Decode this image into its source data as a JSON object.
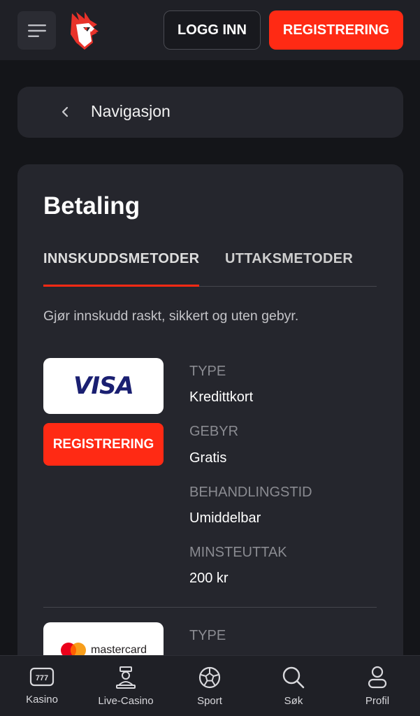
{
  "header": {
    "login_label": "LOGG INN",
    "register_label": "REGISTRERING"
  },
  "nav": {
    "label": "Navigasjon"
  },
  "page": {
    "title": "Betaling",
    "tabs": [
      {
        "label": "INNSKUDDSMETODER",
        "active": true
      },
      {
        "label": "UTTAKSMETODER",
        "active": false
      }
    ],
    "intro": "Gjør innskudd raskt, sikkert og uten gebyr."
  },
  "methods": [
    {
      "logo_text": "VISA",
      "register_label": "REGISTRERING",
      "type_label": "TYPE",
      "type_value": "Kredittkort",
      "fee_label": "GEBYR",
      "fee_value": "Gratis",
      "time_label": "BEHANDLINGSTID",
      "time_value": "Umiddelbar",
      "min_label": "MINSTEUTTAK",
      "min_value": "200 kr"
    },
    {
      "logo_text": "mastercard",
      "type_label": "TYPE"
    }
  ],
  "bottom_nav": [
    {
      "label": "Kasino",
      "icon": "slot-777-icon"
    },
    {
      "label": "Live-Casino",
      "icon": "dealer-icon"
    },
    {
      "label": "Sport",
      "icon": "soccer-ball-icon"
    },
    {
      "label": "Søk",
      "icon": "search-icon"
    },
    {
      "label": "Profil",
      "icon": "user-icon"
    }
  ],
  "colors": {
    "accent": "#ff2a14",
    "background": "#141519",
    "card": "#25262d",
    "visa_blue": "#1a1f71"
  }
}
